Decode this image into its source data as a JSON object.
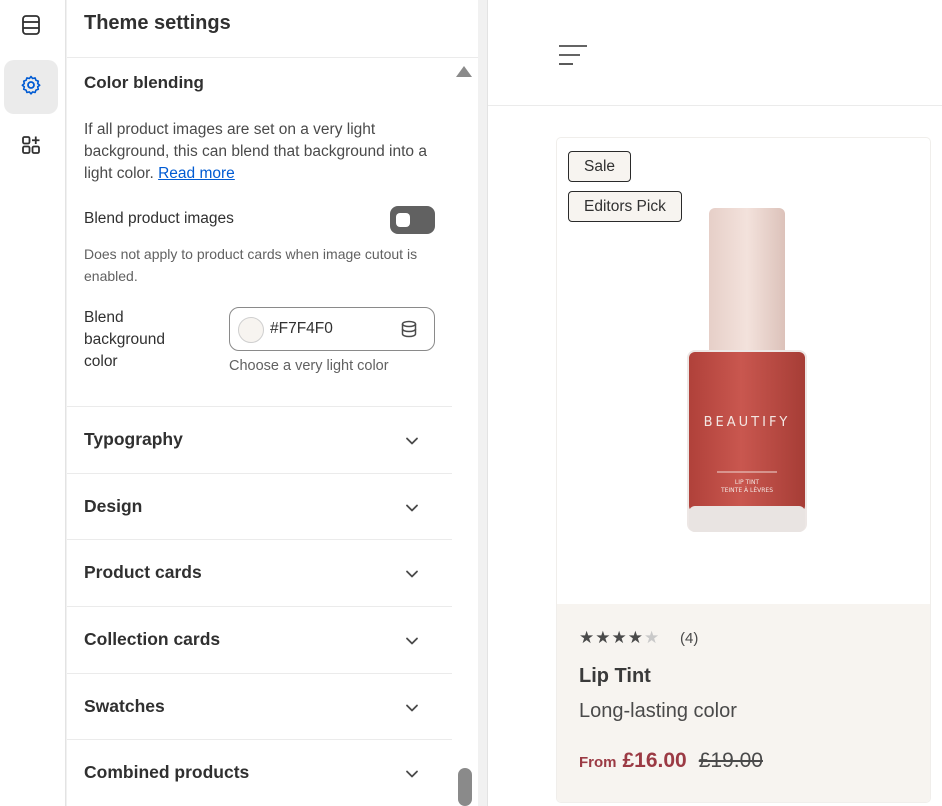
{
  "rail": {
    "items": [
      {
        "icon": "sections-icon"
      },
      {
        "icon": "gear-icon",
        "active": true
      },
      {
        "icon": "apps-icon"
      }
    ]
  },
  "panel": {
    "title": "Theme settings",
    "section": {
      "title": "Color blending",
      "description": "If all product images are set on a very light background, this can blend that background into a light color.",
      "read_more": "Read more",
      "toggle_label": "Blend product images",
      "toggle_on": false,
      "toggle_help": "Does not apply to product cards when image cutout is enabled.",
      "color_label": "Blend background color",
      "color_value": "#F7F4F0",
      "color_help": "Choose a very light color"
    },
    "accordions": [
      {
        "label": "Typography"
      },
      {
        "label": "Design"
      },
      {
        "label": "Product cards"
      },
      {
        "label": "Collection cards"
      },
      {
        "label": "Swatches"
      },
      {
        "label": "Combined products"
      }
    ]
  },
  "preview": {
    "badges": [
      "Sale",
      "Editors Pick"
    ],
    "product": {
      "brand_on_bottle": "BEAUTIFY",
      "bottle_small_text_1": "LIP TINT",
      "bottle_small_text_2": "TEINTE À LÈVRES",
      "rating": 4,
      "rating_max": 5,
      "rating_count": "(4)",
      "title": "Lip Tint",
      "subtitle": "Long-lasting color",
      "price_prefix": "From",
      "price": "£16.00",
      "compare_price": "£19.00"
    }
  },
  "colors": {
    "accent": "#005bd3",
    "price": "#9b3a44",
    "card_background": "#F7F4F0",
    "bottle": "#c4524a"
  }
}
